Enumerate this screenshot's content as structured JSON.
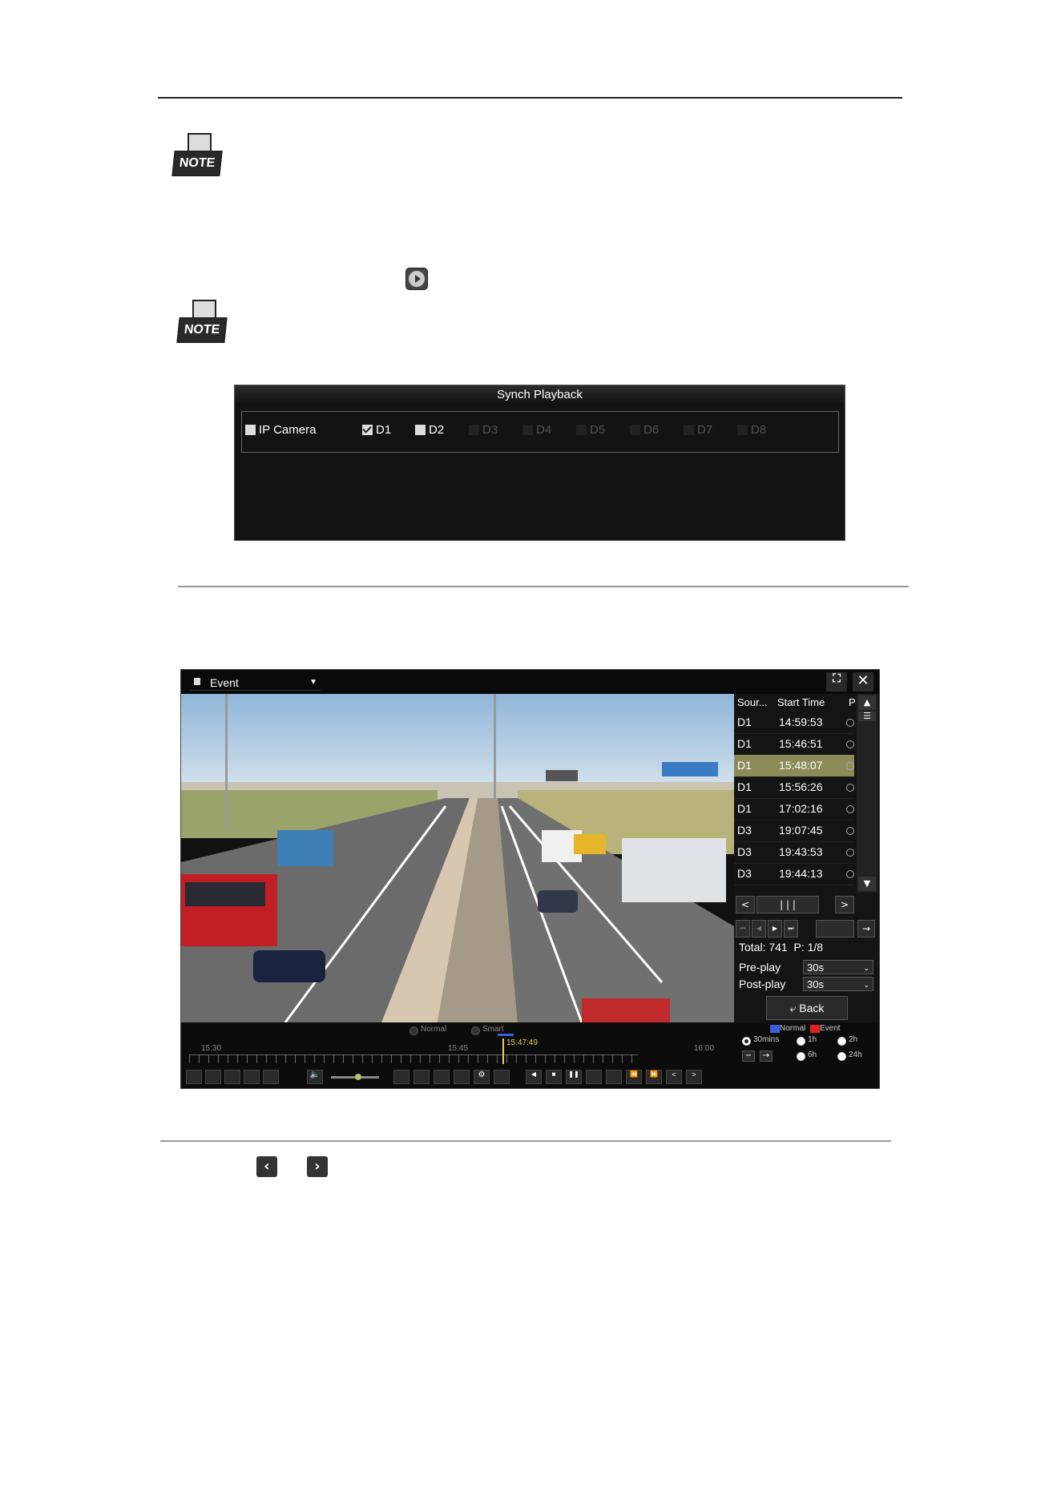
{
  "note_label": "NOTE",
  "synch_playback": {
    "title": "Synch Playback",
    "cameras": [
      {
        "label": "IP Camera",
        "checked": false,
        "enabled": true
      },
      {
        "label": "D1",
        "checked": true,
        "enabled": true
      },
      {
        "label": "D2",
        "checked": false,
        "enabled": true
      },
      {
        "label": "D3",
        "checked": false,
        "enabled": false
      },
      {
        "label": "D4",
        "checked": false,
        "enabled": false
      },
      {
        "label": "D5",
        "checked": false,
        "enabled": false
      },
      {
        "label": "D6",
        "checked": false,
        "enabled": false
      },
      {
        "label": "D7",
        "checked": false,
        "enabled": false
      },
      {
        "label": "D8",
        "checked": false,
        "enabled": false
      }
    ]
  },
  "player": {
    "mode": "Event",
    "list_headers": {
      "source": "Sour...",
      "start_time": "Start Time",
      "p": "P"
    },
    "rows": [
      {
        "source": "D1",
        "time": "14:59:53",
        "selected": false
      },
      {
        "source": "D1",
        "time": "15:46:51",
        "selected": false
      },
      {
        "source": "D1",
        "time": "15:48:07",
        "selected": true
      },
      {
        "source": "D1",
        "time": "15:56:26",
        "selected": false
      },
      {
        "source": "D1",
        "time": "17:02:16",
        "selected": false
      },
      {
        "source": "D3",
        "time": "19:07:45",
        "selected": false
      },
      {
        "source": "D3",
        "time": "19:43:53",
        "selected": false
      },
      {
        "source": "D3",
        "time": "19:44:13",
        "selected": false
      }
    ],
    "page_indicator": "| | |",
    "total": "Total: 741  P: 1/8",
    "pre_play_label": "Pre-play",
    "pre_play_value": "30s",
    "post_play_label": "Post-play",
    "post_play_value": "30s",
    "back_label": "Back",
    "legend": {
      "normal": "Normal",
      "event": "Event",
      "normal_color": "#3b5fe0",
      "event_color": "#e02020"
    },
    "timeline_modes": {
      "normal": "Normal",
      "smart": "Smart"
    },
    "time_marks": [
      "15:30",
      "15:45",
      "16:00"
    ],
    "current_time": "15:47:49",
    "spans": [
      "30mins",
      "1h",
      "2h",
      "6h",
      "24h"
    ],
    "selected_span": "30mins"
  }
}
